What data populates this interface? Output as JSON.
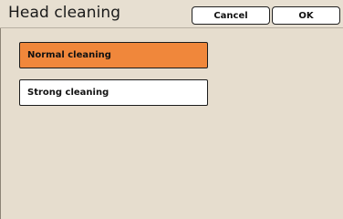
{
  "header": {
    "title": "Head cleaning",
    "cancel_label": "Cancel",
    "ok_label": "OK"
  },
  "options": [
    {
      "label": "Normal cleaning",
      "selected": true
    },
    {
      "label": "Strong cleaning",
      "selected": false
    }
  ],
  "colors": {
    "background": "#e6ddce",
    "selected": "#f0873b",
    "unselected": "#ffffff"
  }
}
